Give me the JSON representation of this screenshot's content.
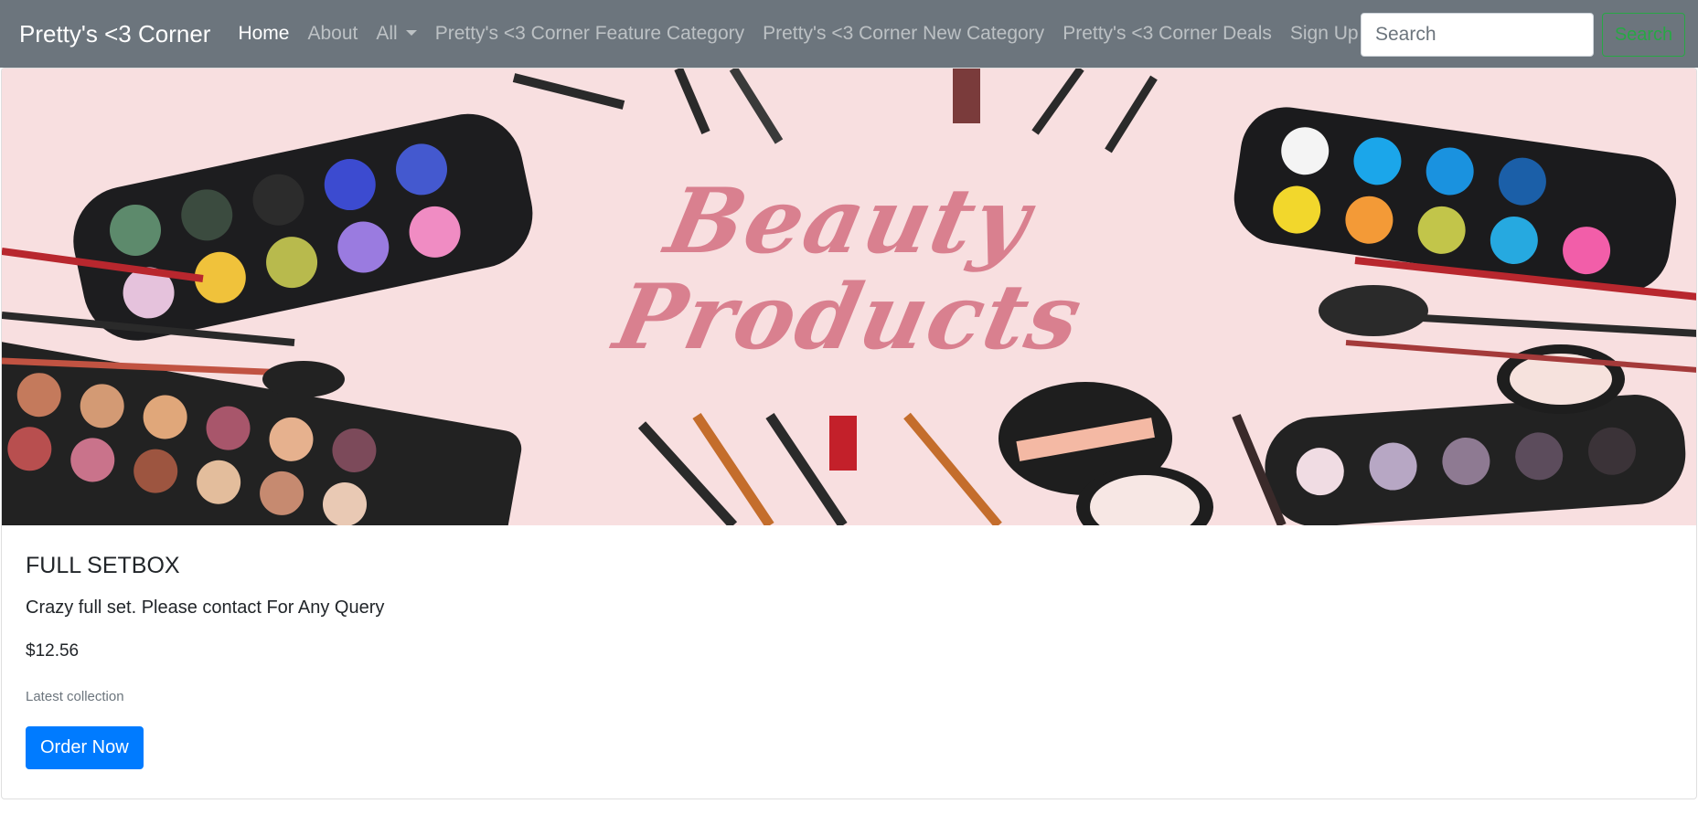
{
  "navbar": {
    "brand": "Pretty's <3 Corner",
    "links": [
      {
        "label": "Home",
        "active": true
      },
      {
        "label": "About"
      },
      {
        "label": "All",
        "dropdown": true
      },
      {
        "label": "Pretty's <3 Corner Feature Category"
      },
      {
        "label": "Pretty's <3 Corner New Category"
      },
      {
        "label": "Pretty's <3 Corner Deals"
      },
      {
        "label": "Sign Up"
      }
    ],
    "search": {
      "placeholder": "Search",
      "button_label": "Search"
    }
  },
  "product": {
    "banner_text": [
      "Beauty",
      "Products"
    ],
    "title": "FULL SETBOX",
    "description": "Crazy full set. Please contact For Any Query",
    "price": "$12.56",
    "note": "Latest collection",
    "button_label": "Order Now"
  },
  "colors": {
    "navbar_bg": "#6c757d",
    "primary": "#007bff",
    "success": "#28a745",
    "banner_bg": "#f8dfe0"
  }
}
